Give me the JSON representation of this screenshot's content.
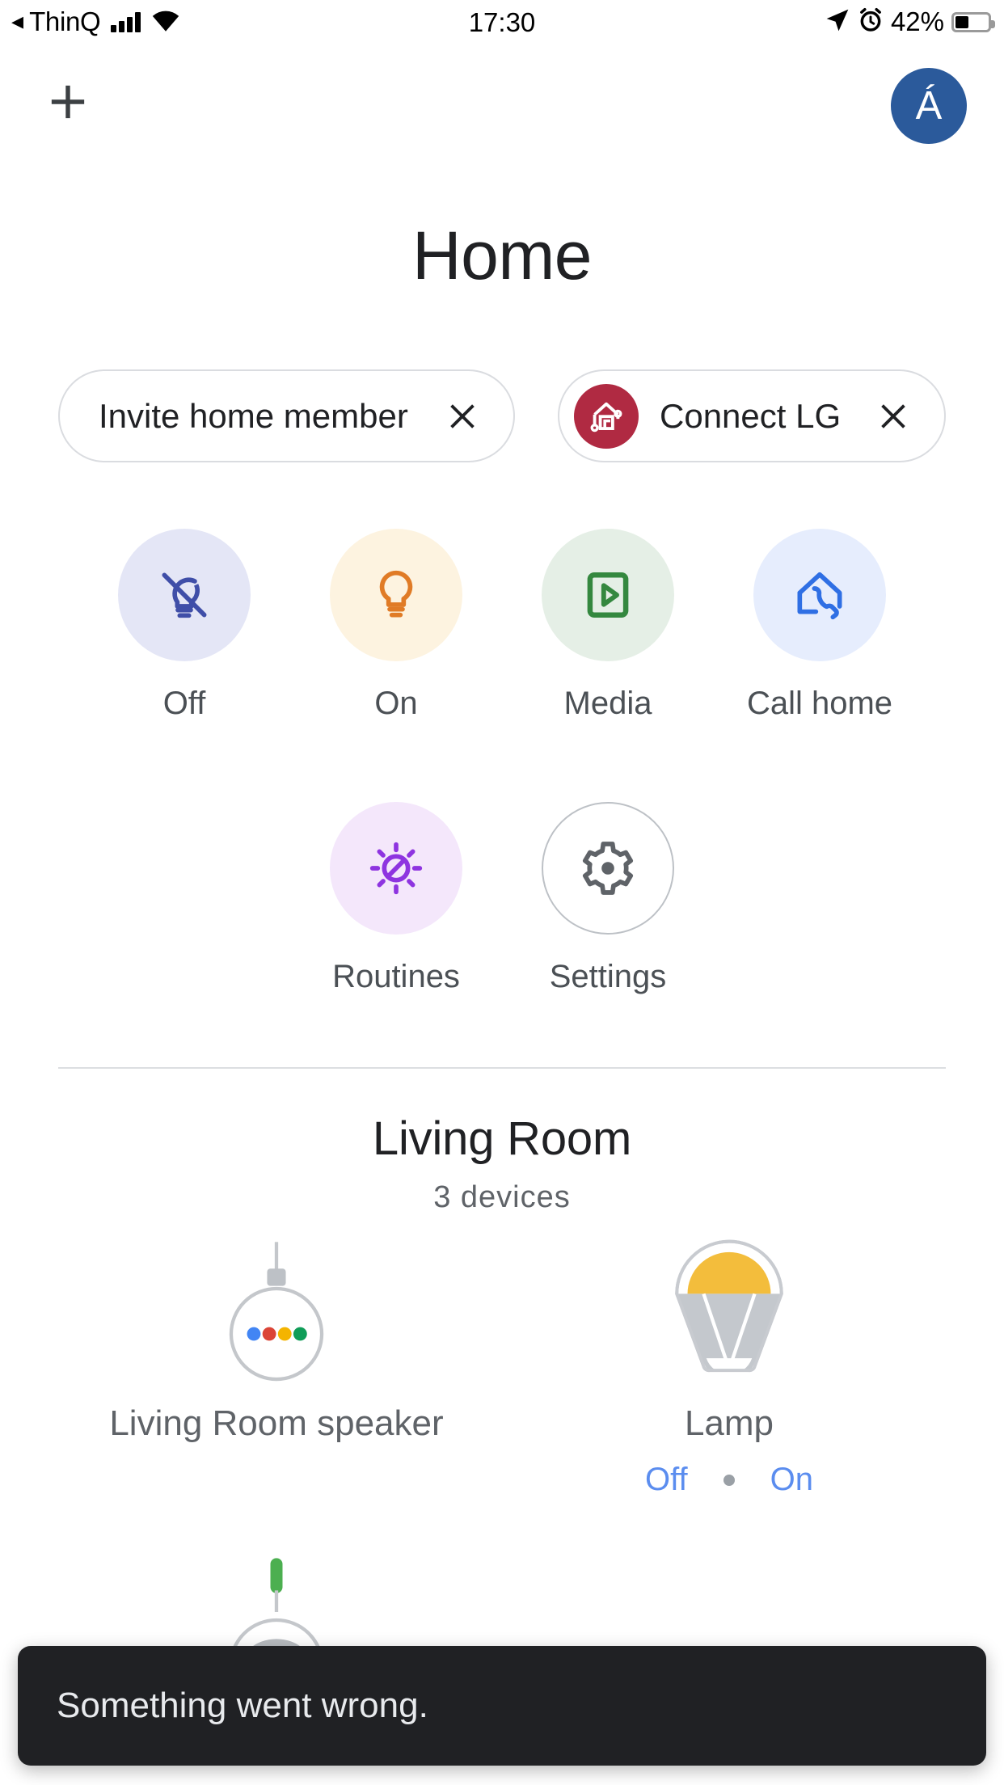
{
  "status_bar": {
    "back_label": "ThinQ",
    "back_arrow_icon": "back-triangle-icon",
    "signal_icon": "cellular-signal-icon",
    "wifi_icon": "wifi-icon",
    "time": "17:30",
    "location_icon": "location-arrow-icon",
    "alarm_icon": "alarm-clock-icon",
    "battery_percent": "42%",
    "battery_icon": "battery-icon"
  },
  "appbar": {
    "add_icon": "plus-icon",
    "avatar_initial": "Á"
  },
  "page_title": "Home",
  "chips": [
    {
      "label": "Invite home member",
      "close_icon": "close-icon",
      "leading_icon": null
    },
    {
      "label": "Connect LG",
      "close_icon": "close-icon",
      "leading_icon": "lg-home-icon"
    }
  ],
  "quick_actions_row1": [
    {
      "label": "Off",
      "icon": "bulb-off-icon",
      "bg": "#e4e6f6",
      "fg": "#3f4ea8"
    },
    {
      "label": "On",
      "icon": "bulb-on-icon",
      "bg": "#fdf3e0",
      "fg": "#e07b26"
    },
    {
      "label": "Media",
      "icon": "media-play-icon",
      "bg": "#e5efe6",
      "fg": "#34883f"
    },
    {
      "label": "Call home",
      "icon": "call-home-icon",
      "bg": "#e6edfd",
      "fg": "#2f6fe4"
    }
  ],
  "quick_actions_row2": [
    {
      "label": "Routines",
      "icon": "routines-sun-icon",
      "bg": "#f4e7fb",
      "fg": "#8e34e0"
    },
    {
      "label": "Settings",
      "icon": "gear-icon",
      "bg": "#ffffff",
      "fg": "#5f6368"
    }
  ],
  "room": {
    "name": "Living Room",
    "device_count_label": "3 devices"
  },
  "devices": [
    {
      "name": "Living Room speaker",
      "icon": "google-home-speaker-icon",
      "actions": []
    },
    {
      "name": "Lamp",
      "icon": "lamp-bulb-icon",
      "actions": [
        "Off",
        "On"
      ],
      "separator_icon": "dot-separator"
    },
    {
      "name": "",
      "icon": "device-partial-icon",
      "actions": []
    }
  ],
  "snackbar": {
    "message": "Something went wrong."
  },
  "colors": {
    "accent_blue": "#5b8def",
    "avatar_blue": "#2b5a9b",
    "lg_red": "#b02a42",
    "snackbar_bg": "#202124",
    "text_primary": "#202124",
    "text_secondary": "#5f6368"
  }
}
